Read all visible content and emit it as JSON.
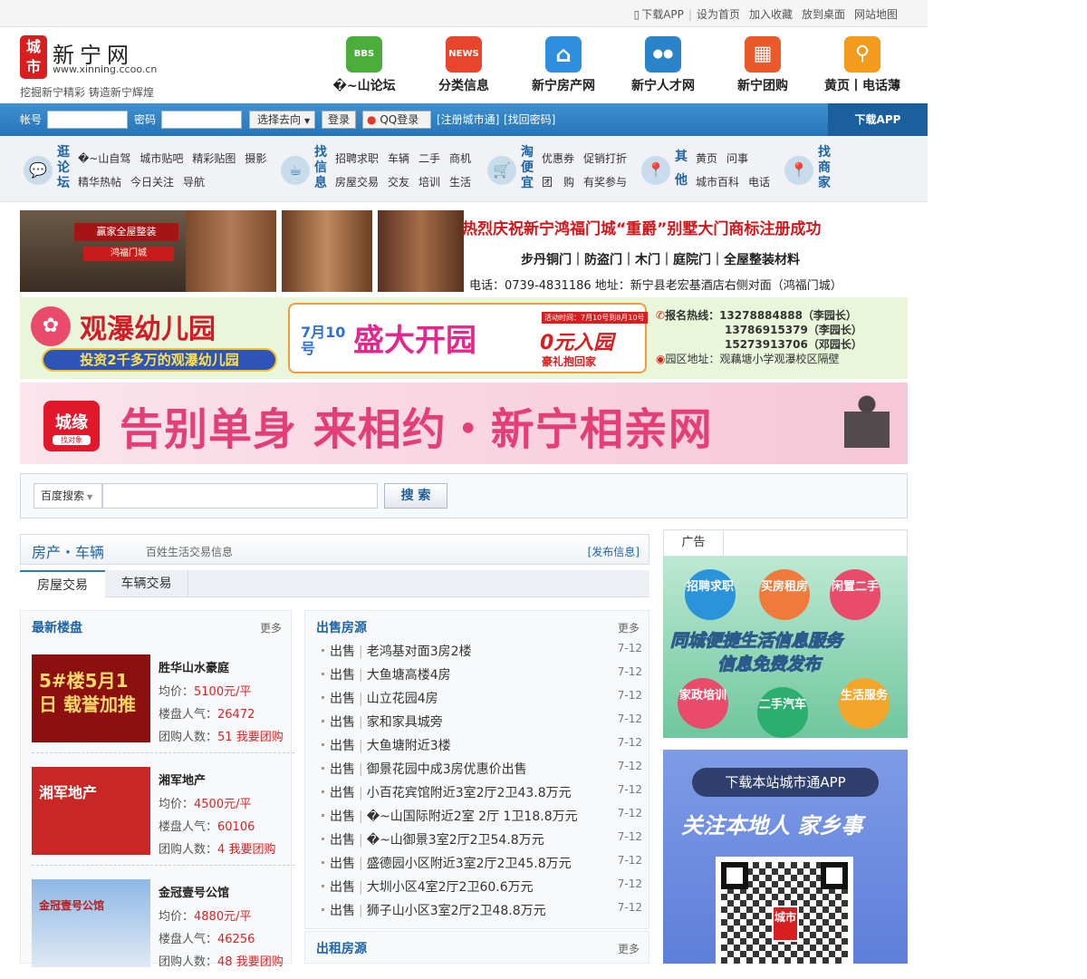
{
  "topbar": {
    "links": [
      "下载APP",
      "设为首页",
      "加入收藏",
      "放到桌面",
      "网站地图"
    ]
  },
  "logo": {
    "mark": "城市",
    "name": "新宁网",
    "url": "www.xinning.ccoo.cn",
    "slogan": "挖掘新宁精彩 铸造新宁辉煌"
  },
  "main_nav": [
    {
      "label": "�~山论坛",
      "icon": "bbs-icon",
      "icon_text": "BBS",
      "color": "#4cae3a"
    },
    {
      "label": "分类信息",
      "icon": "news-icon",
      "icon_text": "NEWS",
      "color": "#e8452c"
    },
    {
      "label": "新宁房产网",
      "icon": "house-icon",
      "icon_text": "⌂",
      "color": "#2e8fde"
    },
    {
      "label": "新宁人才网",
      "icon": "people-icon",
      "icon_text": "●●",
      "color": "#2a84c7"
    },
    {
      "label": "新宁团购",
      "icon": "cart-icon",
      "icon_text": "▦",
      "color": "#e9592a"
    },
    {
      "label": "黄页丨电话薄",
      "icon": "search-icon",
      "icon_text": "⚲",
      "color": "#f29b1d"
    }
  ],
  "login": {
    "account_label": "帐号",
    "password_label": "密码",
    "select_label": "选择去向",
    "login_btn": "登录",
    "qq_btn": "QQ登录",
    "register": "[注册城市通]",
    "find_pwd": "[找回密码]",
    "download": "下载APP"
  },
  "categories": [
    {
      "title": "逛论坛",
      "line1": [
        "�~山自驾",
        "城市贴吧",
        "精彩贴图",
        "摄影"
      ],
      "line2": [
        "精华热帖",
        "今日关注",
        "导航"
      ]
    },
    {
      "title": "找信息",
      "line1": [
        "招聘求职",
        "车辆",
        "二手",
        "商机"
      ],
      "line2": [
        "房屋交易",
        "交友",
        "培训",
        "生活"
      ]
    },
    {
      "title": "淘便宜",
      "line1": [
        "优惠券",
        "促销打折"
      ],
      "line2": [
        "团　购",
        "有奖参与"
      ]
    },
    {
      "title": "其他",
      "line1": [
        "黄页",
        "问事"
      ],
      "line2": [
        "城市百科",
        "电话"
      ]
    },
    {
      "title": "找商家",
      "line1": [],
      "line2": []
    }
  ],
  "banners": {
    "b1": {
      "headline": "热烈庆祝新宁鸿福门城“重爵”别墅大门商标注册成功",
      "products": "步丹铜门｜防盗门｜木门｜庭院门｜全屋整装材料",
      "contact": "电话：0739-4831186  地址：新宁县老宏基酒店右侧对面（鸿福门城）",
      "shop_sign": "鸿福门城",
      "shop_sign2": "赢家全屋整装"
    },
    "b2": {
      "name": "观瀑幼儿园",
      "sub": "投资2千多万的观瀑幼儿园",
      "date": "7月10号",
      "open": "盛大开园",
      "free": "0元入园",
      "gift": "豪礼抱回家",
      "activity": "活动时间：7月10号到8月10号",
      "hotline_label": "报名热线：",
      "phones": [
        "13278884888（李园长）",
        "13786915379（李园长）",
        "15273913706（邓园长）"
      ],
      "address": "园区地址：观藕塘小学观瀑校区隔壁"
    },
    "b3": {
      "logo": "城缘",
      "logo_sub": "找对象",
      "slogan": "告别单身 来相约・新宁相亲网"
    }
  },
  "search": {
    "engine": "百度搜索",
    "button": "搜 索"
  },
  "section": {
    "title": "房产・车辆",
    "subtitle": "百姓生活交易信息",
    "publish": "[发布信息]",
    "tabs": [
      "房屋交易",
      "车辆交易"
    ]
  },
  "loupan": {
    "title": "最新楼盘",
    "more": "更多",
    "items": [
      {
        "name": "胜华山水豪庭",
        "price_label": "均价：",
        "price": "5100元/平",
        "pop_label": "楼盘人气：",
        "pop": "26472",
        "group_label": "团购人数：",
        "group": "51",
        "group_link": "我要团购",
        "img_text": "5#楼5月1日 载誉加推",
        "img_color": "#8d1010"
      },
      {
        "name": "湘军地产",
        "price_label": "均价：",
        "price": "4500元/平",
        "pop_label": "楼盘人气：",
        "pop": "60106",
        "group_label": "团购人数：",
        "group": "4",
        "group_link": "我要团购",
        "img_text": "湘军地产",
        "img_color": "#c92626"
      },
      {
        "name": "金冠壹号公馆",
        "price_label": "均价：",
        "price": "4880元/平",
        "pop_label": "楼盘人气：",
        "pop": "46256",
        "group_label": "团购人数：",
        "group": "48",
        "group_link": "我要团购",
        "img_text": "金冠壹号公馆",
        "img_color": "#6b9fd6"
      }
    ]
  },
  "sale": {
    "title": "出售房源",
    "more": "更多",
    "items": [
      {
        "cat": "出售",
        "title": "老鸿基对面3房2楼",
        "date": "7-12"
      },
      {
        "cat": "出售",
        "title": "大鱼塘高楼4房",
        "date": "7-12"
      },
      {
        "cat": "出售",
        "title": "山立花园4房",
        "date": "7-12"
      },
      {
        "cat": "出售",
        "title": "家和家具城旁",
        "date": "7-12"
      },
      {
        "cat": "出售",
        "title": "大鱼塘附近3楼",
        "date": "7-12"
      },
      {
        "cat": "出售",
        "title": "御景花园中成3房优惠价出售",
        "date": "7-12"
      },
      {
        "cat": "出售",
        "title": "小百花宾馆附近3室2厅2卫43.8万元",
        "date": "7-12"
      },
      {
        "cat": "出售",
        "title": "�~山国际附近2室 2厅 1卫18.8万元",
        "date": "7-12"
      },
      {
        "cat": "出售",
        "title": "�~山御景3室2厅2卫54.8万元",
        "date": "7-12"
      },
      {
        "cat": "出售",
        "title": "盛德园小区附近3室2厅2卫45.8万元",
        "date": "7-12"
      },
      {
        "cat": "出售",
        "title": "大圳小区4室2厅2卫60.6万元",
        "date": "7-12"
      },
      {
        "cat": "出售",
        "title": "狮子山小区3室2厅2卫48.8万元",
        "date": "7-12"
      }
    ]
  },
  "rent": {
    "title": "出租房源",
    "more": "更多"
  },
  "ad": {
    "label": "广告",
    "bubbles": [
      "招聘求职",
      "买房租房",
      "闲置二手",
      "家政培训",
      "二手汽车",
      "生活服务"
    ],
    "line1": "同城便捷生活信息服务",
    "line2": "信息免费发布",
    "app_title": "下载本站城市通APP",
    "app_slogan": "关注本地人 家乡事",
    "qr_center": "城市"
  }
}
